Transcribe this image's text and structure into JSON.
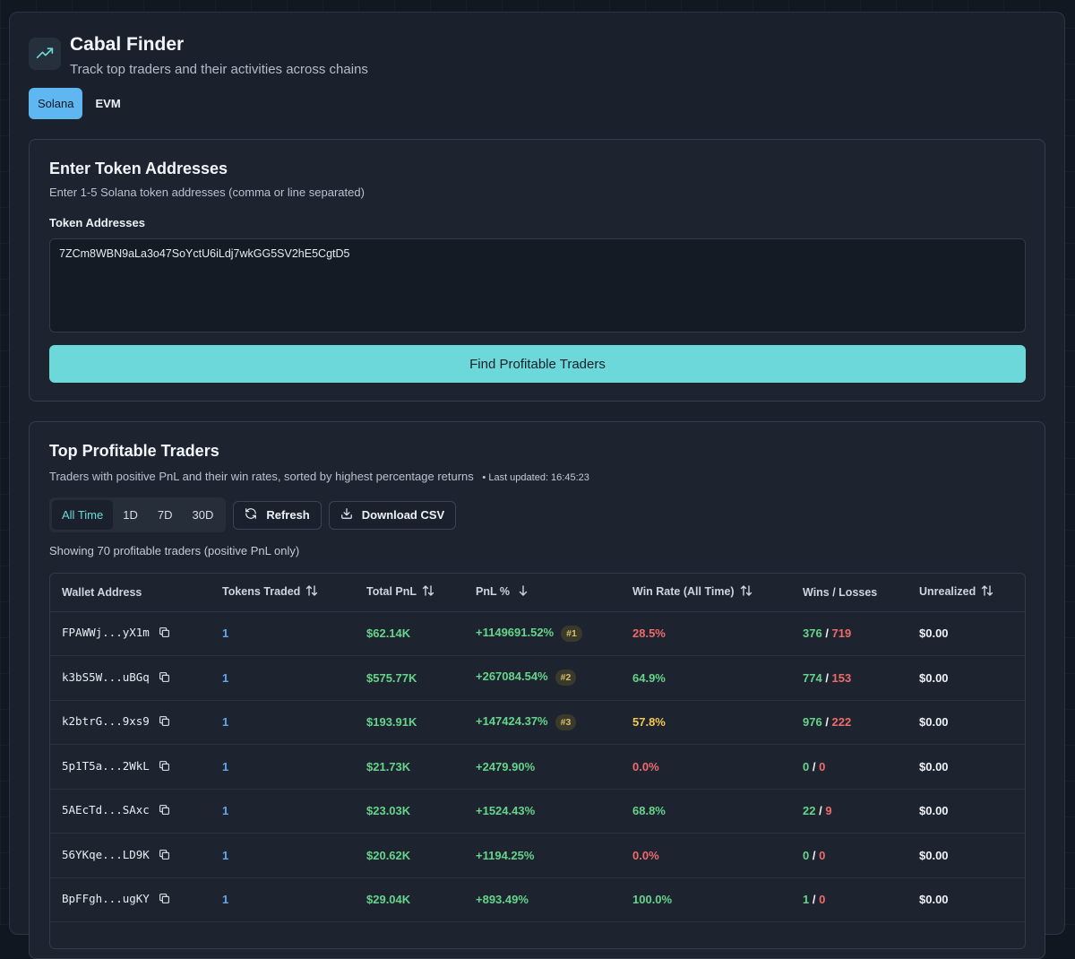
{
  "app": {
    "title": "Cabal Finder",
    "subtitle": "Track top traders and their activities across chains",
    "chains": [
      "Solana",
      "EVM"
    ],
    "active_chain": "Solana"
  },
  "input_card": {
    "title": "Enter Token Addresses",
    "description": "Enter 1-5 Solana token addresses (comma or line separated)",
    "field_label": "Token Addresses",
    "field_value": "7ZCm8WBN9aLa3o47SoYctU6iLdj7wkGG5SV2hE5CgtD5",
    "submit_label": "Find Profitable Traders"
  },
  "results": {
    "title": "Top Profitable Traders",
    "description": "Traders with positive PnL and their win rates, sorted by highest percentage returns",
    "last_updated": "• Last updated: 16:45:23",
    "periods": [
      "All Time",
      "1D",
      "7D",
      "30D"
    ],
    "active_period": "All Time",
    "refresh_label": "Refresh",
    "download_label": "Download CSV",
    "showing_text": "Showing 70 profitable traders (positive PnL only)",
    "columns": [
      "Wallet Address",
      "Tokens Traded",
      "Total PnL",
      "PnL %",
      "Win Rate (All Time)",
      "Wins / Losses",
      "Unrealized"
    ],
    "rows": [
      {
        "wallet": "FPAWWj...yX1m",
        "tokens": "1",
        "pnl": "$62.14K",
        "pnl_pct": "+1149691.52%",
        "rank": "#1",
        "win_rate": "28.5%",
        "win_color": "#ee6b6b",
        "wins": "376",
        "losses": "719",
        "unrealized": "$0.00"
      },
      {
        "wallet": "k3bS5W...uBGq",
        "tokens": "1",
        "pnl": "$575.77K",
        "pnl_pct": "+267084.54%",
        "rank": "#2",
        "win_rate": "64.9%",
        "win_color": "#66d48a",
        "wins": "774",
        "losses": "153",
        "unrealized": "$0.00"
      },
      {
        "wallet": "k2btrG...9xs9",
        "tokens": "1",
        "pnl": "$193.91K",
        "pnl_pct": "+147424.37%",
        "rank": "#3",
        "win_rate": "57.8%",
        "win_color": "#f5c84d",
        "wins": "976",
        "losses": "222",
        "unrealized": "$0.00"
      },
      {
        "wallet": "5p1T5a...2WkL",
        "tokens": "1",
        "pnl": "$21.73K",
        "pnl_pct": "+2479.90%",
        "rank": "",
        "win_rate": "0.0%",
        "win_color": "#ee6b6b",
        "wins": "0",
        "losses": "0",
        "unrealized": "$0.00"
      },
      {
        "wallet": "5AEcTd...SAxc",
        "tokens": "1",
        "pnl": "$23.03K",
        "pnl_pct": "+1524.43%",
        "rank": "",
        "win_rate": "68.8%",
        "win_color": "#66d48a",
        "wins": "22",
        "losses": "9",
        "unrealized": "$0.00"
      },
      {
        "wallet": "56YKqe...LD9K",
        "tokens": "1",
        "pnl": "$20.62K",
        "pnl_pct": "+1194.25%",
        "rank": "",
        "win_rate": "0.0%",
        "win_color": "#ee6b6b",
        "wins": "0",
        "losses": "0",
        "unrealized": "$0.00"
      },
      {
        "wallet": "BpFFgh...ugKY",
        "tokens": "1",
        "pnl": "$29.04K",
        "pnl_pct": "+893.49%",
        "rank": "",
        "win_rate": "100.0%",
        "win_color": "#66d48a",
        "wins": "1",
        "losses": "0",
        "unrealized": "$0.00"
      }
    ]
  }
}
